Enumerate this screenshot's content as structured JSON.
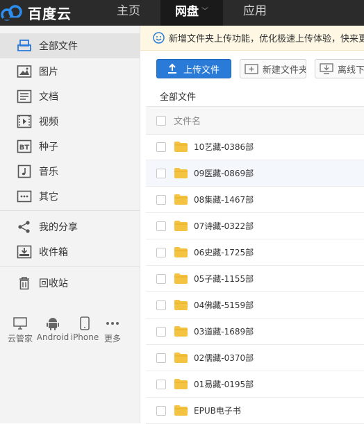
{
  "brand": {
    "name": "百度云"
  },
  "nav": {
    "home": "主页",
    "disk": "网盘",
    "apps": "应用"
  },
  "sidebar": {
    "items": [
      {
        "label": "全部文件",
        "icon": "all-files-icon"
      },
      {
        "label": "图片",
        "icon": "image-icon"
      },
      {
        "label": "文档",
        "icon": "document-icon"
      },
      {
        "label": "视频",
        "icon": "video-icon"
      },
      {
        "label": "种子",
        "icon": "bt-icon"
      },
      {
        "label": "音乐",
        "icon": "music-icon"
      },
      {
        "label": "其它",
        "icon": "other-icon"
      },
      {
        "label": "我的分享",
        "icon": "share-icon"
      },
      {
        "label": "收件箱",
        "icon": "inbox-icon"
      },
      {
        "label": "回收站",
        "icon": "trash-icon"
      }
    ],
    "clients": [
      {
        "label": "云管家",
        "icon": "desktop-icon"
      },
      {
        "label": "Android",
        "icon": "android-icon"
      },
      {
        "label": "iPhone",
        "icon": "iphone-icon"
      },
      {
        "label": "更多",
        "icon": "more-icon"
      }
    ]
  },
  "notice": {
    "text": "新增文件夹上传功能，优化极速上传体验，快来更新吧"
  },
  "toolbar": {
    "upload": "上传文件",
    "new_folder": "新建文件夹",
    "offline": "离线下载"
  },
  "breadcrumb": "全部文件",
  "list": {
    "header": "文件名",
    "rows": [
      "10艺藏-0386部",
      "09医藏-0869部",
      "08集藏-1467部",
      "07诗藏-0322部",
      "06史藏-1725部",
      "05子藏-1155部",
      "04佛藏-5159部",
      "03道藏-1689部",
      "02儒藏-0370部",
      "01易藏-0195部",
      "EPUB电子书"
    ]
  },
  "colors": {
    "topbar": "#2b2b2b",
    "accent": "#2a7ad8",
    "folder": "#f5c342"
  }
}
